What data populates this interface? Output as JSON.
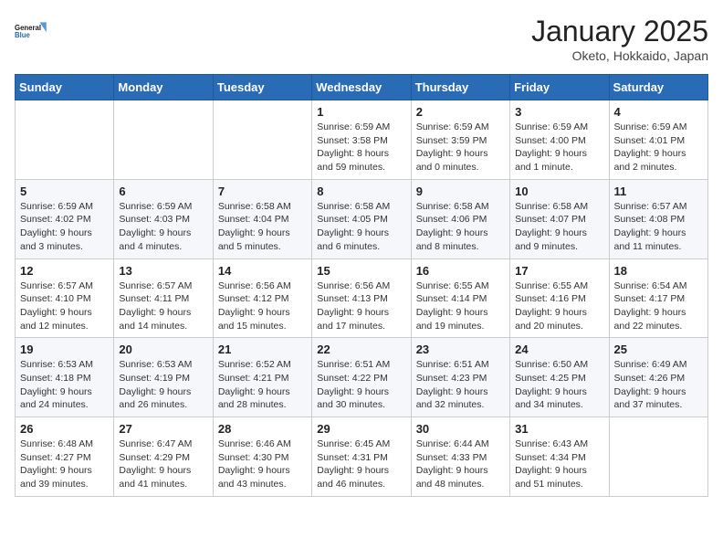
{
  "header": {
    "logo_line1": "General",
    "logo_line2": "Blue",
    "month_title": "January 2025",
    "location": "Oketo, Hokkaido, Japan"
  },
  "weekdays": [
    "Sunday",
    "Monday",
    "Tuesday",
    "Wednesday",
    "Thursday",
    "Friday",
    "Saturday"
  ],
  "weeks": [
    [
      {
        "day": "",
        "info": ""
      },
      {
        "day": "",
        "info": ""
      },
      {
        "day": "",
        "info": ""
      },
      {
        "day": "1",
        "info": "Sunrise: 6:59 AM\nSunset: 3:58 PM\nDaylight: 8 hours and 59 minutes."
      },
      {
        "day": "2",
        "info": "Sunrise: 6:59 AM\nSunset: 3:59 PM\nDaylight: 9 hours and 0 minutes."
      },
      {
        "day": "3",
        "info": "Sunrise: 6:59 AM\nSunset: 4:00 PM\nDaylight: 9 hours and 1 minute."
      },
      {
        "day": "4",
        "info": "Sunrise: 6:59 AM\nSunset: 4:01 PM\nDaylight: 9 hours and 2 minutes."
      }
    ],
    [
      {
        "day": "5",
        "info": "Sunrise: 6:59 AM\nSunset: 4:02 PM\nDaylight: 9 hours and 3 minutes."
      },
      {
        "day": "6",
        "info": "Sunrise: 6:59 AM\nSunset: 4:03 PM\nDaylight: 9 hours and 4 minutes."
      },
      {
        "day": "7",
        "info": "Sunrise: 6:58 AM\nSunset: 4:04 PM\nDaylight: 9 hours and 5 minutes."
      },
      {
        "day": "8",
        "info": "Sunrise: 6:58 AM\nSunset: 4:05 PM\nDaylight: 9 hours and 6 minutes."
      },
      {
        "day": "9",
        "info": "Sunrise: 6:58 AM\nSunset: 4:06 PM\nDaylight: 9 hours and 8 minutes."
      },
      {
        "day": "10",
        "info": "Sunrise: 6:58 AM\nSunset: 4:07 PM\nDaylight: 9 hours and 9 minutes."
      },
      {
        "day": "11",
        "info": "Sunrise: 6:57 AM\nSunset: 4:08 PM\nDaylight: 9 hours and 11 minutes."
      }
    ],
    [
      {
        "day": "12",
        "info": "Sunrise: 6:57 AM\nSunset: 4:10 PM\nDaylight: 9 hours and 12 minutes."
      },
      {
        "day": "13",
        "info": "Sunrise: 6:57 AM\nSunset: 4:11 PM\nDaylight: 9 hours and 14 minutes."
      },
      {
        "day": "14",
        "info": "Sunrise: 6:56 AM\nSunset: 4:12 PM\nDaylight: 9 hours and 15 minutes."
      },
      {
        "day": "15",
        "info": "Sunrise: 6:56 AM\nSunset: 4:13 PM\nDaylight: 9 hours and 17 minutes."
      },
      {
        "day": "16",
        "info": "Sunrise: 6:55 AM\nSunset: 4:14 PM\nDaylight: 9 hours and 19 minutes."
      },
      {
        "day": "17",
        "info": "Sunrise: 6:55 AM\nSunset: 4:16 PM\nDaylight: 9 hours and 20 minutes."
      },
      {
        "day": "18",
        "info": "Sunrise: 6:54 AM\nSunset: 4:17 PM\nDaylight: 9 hours and 22 minutes."
      }
    ],
    [
      {
        "day": "19",
        "info": "Sunrise: 6:53 AM\nSunset: 4:18 PM\nDaylight: 9 hours and 24 minutes."
      },
      {
        "day": "20",
        "info": "Sunrise: 6:53 AM\nSunset: 4:19 PM\nDaylight: 9 hours and 26 minutes."
      },
      {
        "day": "21",
        "info": "Sunrise: 6:52 AM\nSunset: 4:21 PM\nDaylight: 9 hours and 28 minutes."
      },
      {
        "day": "22",
        "info": "Sunrise: 6:51 AM\nSunset: 4:22 PM\nDaylight: 9 hours and 30 minutes."
      },
      {
        "day": "23",
        "info": "Sunrise: 6:51 AM\nSunset: 4:23 PM\nDaylight: 9 hours and 32 minutes."
      },
      {
        "day": "24",
        "info": "Sunrise: 6:50 AM\nSunset: 4:25 PM\nDaylight: 9 hours and 34 minutes."
      },
      {
        "day": "25",
        "info": "Sunrise: 6:49 AM\nSunset: 4:26 PM\nDaylight: 9 hours and 37 minutes."
      }
    ],
    [
      {
        "day": "26",
        "info": "Sunrise: 6:48 AM\nSunset: 4:27 PM\nDaylight: 9 hours and 39 minutes."
      },
      {
        "day": "27",
        "info": "Sunrise: 6:47 AM\nSunset: 4:29 PM\nDaylight: 9 hours and 41 minutes."
      },
      {
        "day": "28",
        "info": "Sunrise: 6:46 AM\nSunset: 4:30 PM\nDaylight: 9 hours and 43 minutes."
      },
      {
        "day": "29",
        "info": "Sunrise: 6:45 AM\nSunset: 4:31 PM\nDaylight: 9 hours and 46 minutes."
      },
      {
        "day": "30",
        "info": "Sunrise: 6:44 AM\nSunset: 4:33 PM\nDaylight: 9 hours and 48 minutes."
      },
      {
        "day": "31",
        "info": "Sunrise: 6:43 AM\nSunset: 4:34 PM\nDaylight: 9 hours and 51 minutes."
      },
      {
        "day": "",
        "info": ""
      }
    ]
  ]
}
